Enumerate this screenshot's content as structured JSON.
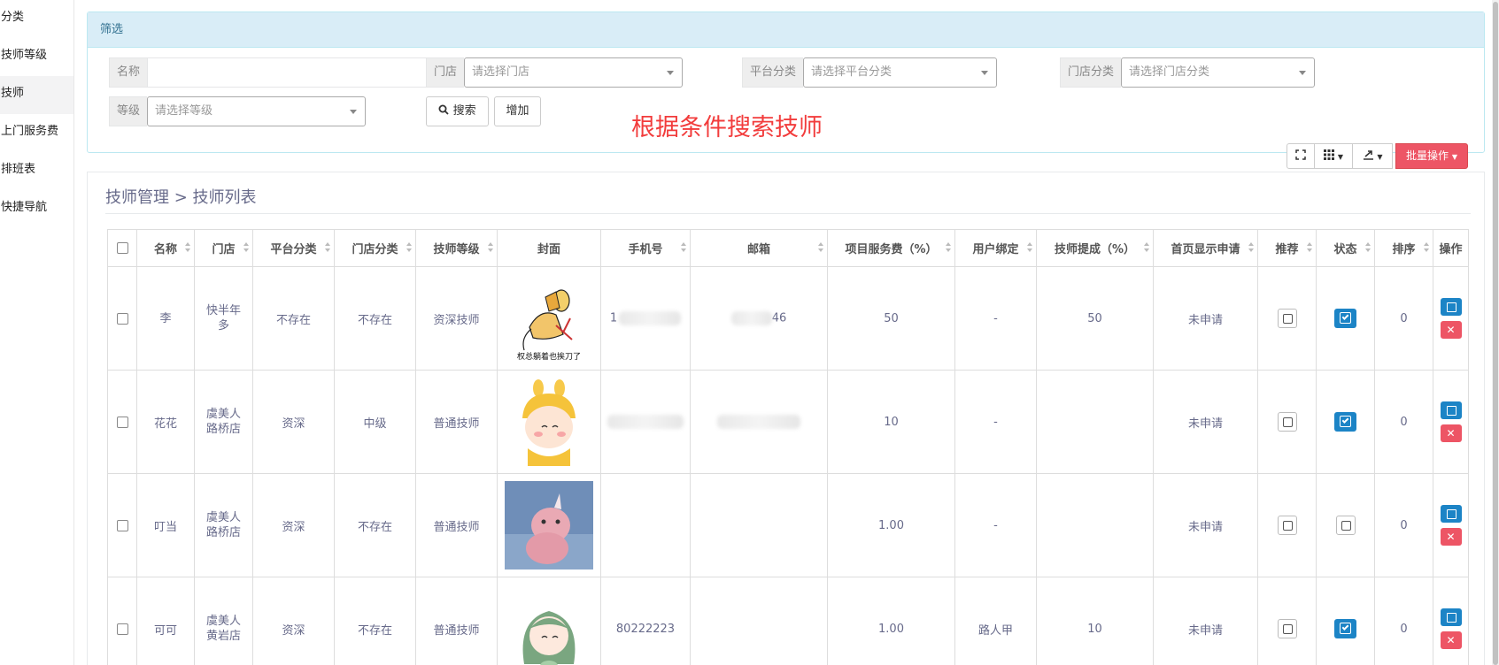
{
  "sidebar": {
    "items": [
      {
        "label": "分类"
      },
      {
        "label": "技师等级"
      },
      {
        "label": "技师"
      },
      {
        "label": "上门服务费"
      },
      {
        "label": "排班表"
      },
      {
        "label": "快捷导航"
      }
    ]
  },
  "filter": {
    "title": "筛选",
    "name_label": "名称",
    "name_value": "",
    "store_label": "门店",
    "store_placeholder": "请选择门店",
    "platform_label": "平台分类",
    "platform_placeholder": "请选择平台分类",
    "store_category_label": "门店分类",
    "store_category_placeholder": "请选择门店分类",
    "level_label": "等级",
    "level_placeholder": "请选择等级",
    "search_label": "搜索",
    "add_label": "增加"
  },
  "annotation": "根据条件搜索技师",
  "toolbar": {
    "batch_label": "批量操作"
  },
  "breadcrumb": {
    "text": "技师管理 > 技师列表"
  },
  "table": {
    "headers": [
      "名称",
      "门店",
      "平台分类",
      "门店分类",
      "技师等级",
      "封面",
      "手机号",
      "邮箱",
      "项目服务费（%）",
      "用户绑定",
      "技师提成（%）",
      "首页显示申请",
      "推荐",
      "状态",
      "排序",
      "操作"
    ],
    "rows": [
      {
        "name": "李",
        "store": "快半年多",
        "platform": "不存在",
        "store_cat": "不存在",
        "level": "资深技师",
        "cover_caption": "权总躺着也挨刀了",
        "phone": "1",
        "email": "46",
        "service_fee": "50",
        "bind": "-",
        "commission": "50",
        "apply": "未申请",
        "status_on": true,
        "sort": "0"
      },
      {
        "name": "花花",
        "store": "虞美人路桥店",
        "platform": "资深",
        "store_cat": "中级",
        "level": "普通技师",
        "cover_caption": "",
        "phone": "",
        "email": "",
        "service_fee": "10",
        "bind": "-",
        "commission": "",
        "apply": "未申请",
        "status_on": true,
        "sort": "0"
      },
      {
        "name": "叮当",
        "store": "虞美人路桥店",
        "platform": "资深",
        "store_cat": "不存在",
        "level": "普通技师",
        "cover_caption": "",
        "phone": "",
        "email": "",
        "service_fee": "1.00",
        "bind": "-",
        "commission": "",
        "apply": "未申请",
        "status_on": false,
        "sort": "0"
      },
      {
        "name": "可可",
        "store": "虞美人黄岩店",
        "platform": "资深",
        "store_cat": "不存在",
        "level": "普通技师",
        "cover_caption": "",
        "phone": "80222223",
        "email": "",
        "service_fee": "1.00",
        "bind": "路人甲",
        "commission": "10",
        "apply": "未申请",
        "status_on": true,
        "sort": "0"
      }
    ]
  },
  "colors": {
    "accent_blue": "#1c84c6",
    "danger_red": "#ed5565",
    "annotation_red": "#f23c3c",
    "panel_header": "#d9edf7"
  },
  "icons": {
    "search": "search-icon",
    "fullscreen": "fullscreen-icon",
    "columns": "columns-grid-icon",
    "export": "export-icon",
    "edit": "edit-icon",
    "delete": "delete-icon"
  }
}
